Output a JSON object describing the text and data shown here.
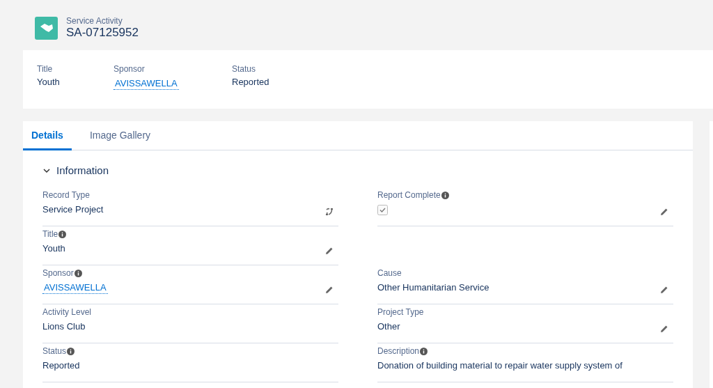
{
  "header": {
    "object_type": "Service Activity",
    "record_name": "SA-07125952"
  },
  "highlights": [
    {
      "label": "Title",
      "value": "Youth",
      "kind": "text"
    },
    {
      "label": "Sponsor",
      "value": "AVISSAWELLA",
      "kind": "link"
    },
    {
      "label": "Status",
      "value": "Reported",
      "kind": "text"
    }
  ],
  "tabs": [
    {
      "label": "Details",
      "selected": true
    },
    {
      "label": "Image Gallery",
      "selected": false
    }
  ],
  "section": {
    "title": "Information",
    "expanded": true
  },
  "rows": [
    {
      "left": {
        "label": "Record Type",
        "info": false,
        "kind": "text",
        "value": "Service Project",
        "editable": false,
        "changeable": true
      },
      "right": {
        "label": "Report Complete",
        "info": true,
        "kind": "checkbox",
        "checked": true,
        "editable": true,
        "changeable": false
      }
    },
    {
      "left": {
        "label": "Title",
        "info": true,
        "kind": "text",
        "value": "Youth",
        "editable": true,
        "changeable": false
      }
    },
    {
      "left": {
        "label": "Sponsor",
        "info": true,
        "kind": "link",
        "value": "AVISSAWELLA",
        "editable": true,
        "changeable": false
      },
      "right": {
        "label": "Cause",
        "info": false,
        "kind": "text",
        "value": "Other Humanitarian Service",
        "editable": true,
        "changeable": false
      }
    },
    {
      "left": {
        "label": "Activity Level",
        "info": false,
        "kind": "text",
        "value": "Lions Club",
        "editable": false,
        "changeable": false
      },
      "right": {
        "label": "Project Type",
        "info": false,
        "kind": "text",
        "value": "Other",
        "editable": true,
        "changeable": false
      }
    },
    {
      "left": {
        "label": "Status",
        "info": true,
        "kind": "text",
        "value": "Reported",
        "editable": false,
        "changeable": false
      },
      "right": {
        "label": "Description",
        "info": true,
        "kind": "text",
        "value": "Donation of building material to repair water supply system of",
        "editable": false,
        "changeable": false
      }
    }
  ]
}
